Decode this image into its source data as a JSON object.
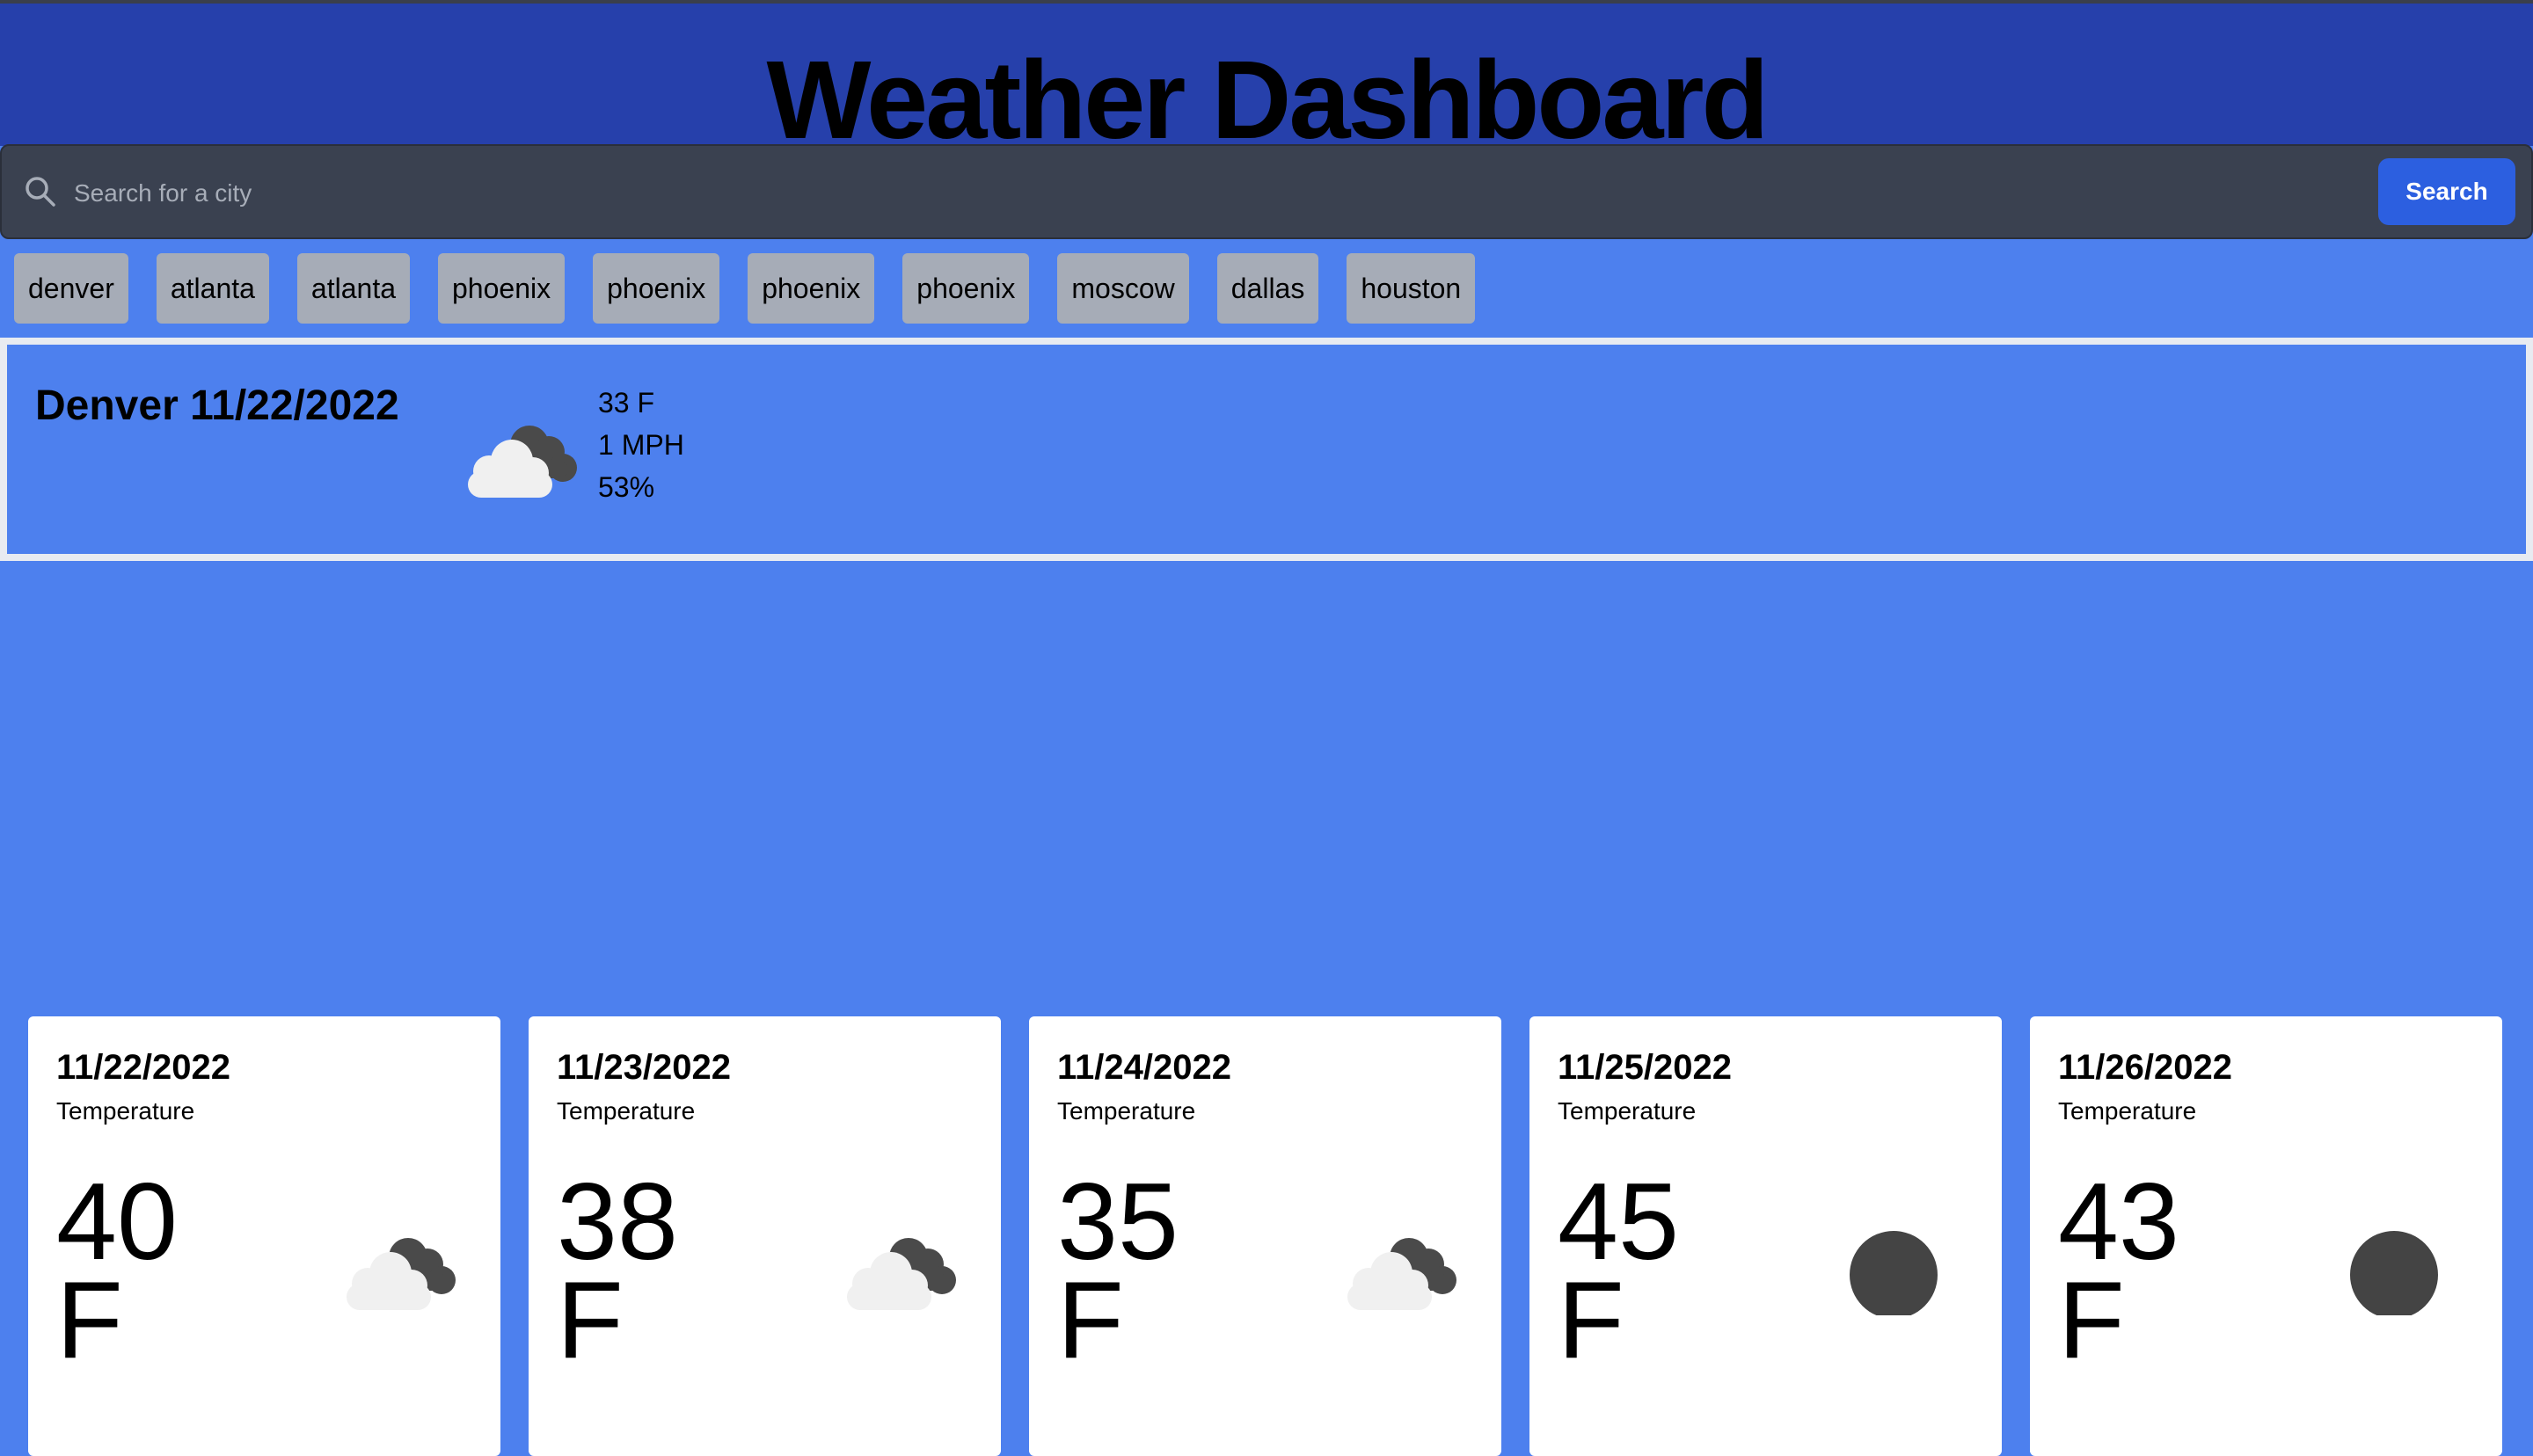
{
  "header": {
    "title": "Weather Dashboard",
    "bg_color": "#2640ab"
  },
  "search": {
    "placeholder": "Search for a city",
    "value": "",
    "button_label": "Search",
    "button_color": "#2c5fe0"
  },
  "history": [
    "denver",
    "atlanta",
    "atlanta",
    "phoenix",
    "phoenix",
    "phoenix",
    "phoenix",
    "moscow",
    "dallas",
    "houston"
  ],
  "current": {
    "title": "Denver 11/22/2022",
    "icon": "cloudy-icon",
    "temp": "33 F",
    "wind": "1 MPH",
    "humidity": "53%"
  },
  "forecast": [
    {
      "date": "11/22/2022",
      "label": "Temperature",
      "temp": "40",
      "unit": "F",
      "icon": "cloudy-icon"
    },
    {
      "date": "11/23/2022",
      "label": "Temperature",
      "temp": "38",
      "unit": "F",
      "icon": "cloudy-icon"
    },
    {
      "date": "11/24/2022",
      "label": "Temperature",
      "temp": "35",
      "unit": "F",
      "icon": "cloudy-icon"
    },
    {
      "date": "11/25/2022",
      "label": "Temperature",
      "temp": "45",
      "unit": "F",
      "icon": "dark-circle-icon"
    },
    {
      "date": "11/26/2022",
      "label": "Temperature",
      "temp": "43",
      "unit": "F",
      "icon": "dark-circle-icon"
    }
  ],
  "colors": {
    "page_bg": "#4d80ee",
    "card_bg": "#ffffff",
    "history_bg": "#a6acb7"
  }
}
